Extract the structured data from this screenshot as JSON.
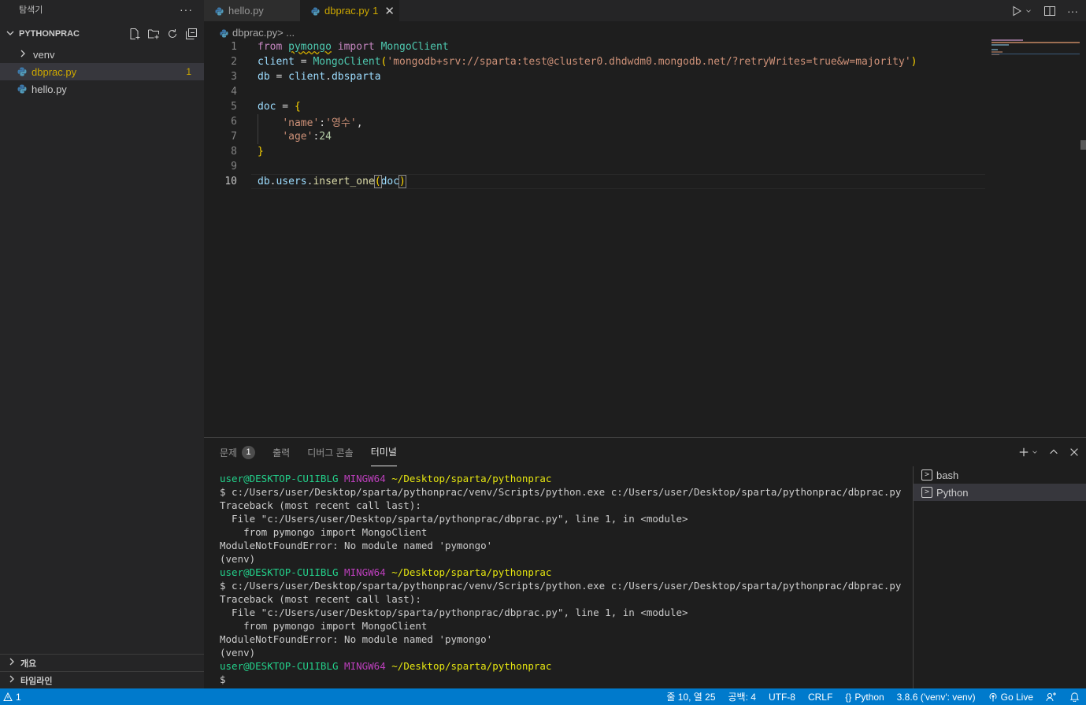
{
  "sidebar": {
    "title": "탐색기",
    "more": "···",
    "folder": "PYTHONPRAC",
    "items": [
      {
        "label": "venv",
        "type": "folder"
      },
      {
        "label": "dbprac.py",
        "type": "file",
        "badge": "1"
      },
      {
        "label": "hello.py",
        "type": "file"
      }
    ],
    "bottom": [
      "개요",
      "타임라인"
    ]
  },
  "tabs": [
    {
      "label": "hello.py"
    },
    {
      "label": "dbprac.py",
      "num": "1",
      "close": "✕"
    }
  ],
  "breadcrumb": {
    "file": "dbprac.py",
    "sep": " > ..."
  },
  "editor": {
    "line_numbers": [
      "1",
      "2",
      "3",
      "4",
      "5",
      "6",
      "7",
      "8",
      "9",
      "10"
    ],
    "current_line": "10"
  },
  "panel": {
    "tabs": [
      {
        "label": "문제",
        "count": "1"
      },
      {
        "label": "출력"
      },
      {
        "label": "디버그 콘솔"
      },
      {
        "label": "터미널"
      }
    ],
    "terminal_lines": [
      {
        "kind": "prompt",
        "user": "user@DESKTOP-CU1IBLG",
        "env": "MINGW64",
        "path": "~/Desktop/sparta/pythonprac"
      },
      {
        "kind": "text",
        "text": "$ c:/Users/user/Desktop/sparta/pythonprac/venv/Scripts/python.exe c:/Users/user/Desktop/sparta/pythonprac/dbprac.py"
      },
      {
        "kind": "text",
        "text": "Traceback (most recent call last):"
      },
      {
        "kind": "text",
        "text": "  File \"c:/Users/user/Desktop/sparta/pythonprac/dbprac.py\", line 1, in <module>"
      },
      {
        "kind": "text",
        "text": "    from pymongo import MongoClient"
      },
      {
        "kind": "text",
        "text": "ModuleNotFoundError: No module named 'pymongo'"
      },
      {
        "kind": "text",
        "text": "(venv)"
      },
      {
        "kind": "prompt",
        "user": "user@DESKTOP-CU1IBLG",
        "env": "MINGW64",
        "path": "~/Desktop/sparta/pythonprac"
      },
      {
        "kind": "text",
        "text": "$ c:/Users/user/Desktop/sparta/pythonprac/venv/Scripts/python.exe c:/Users/user/Desktop/sparta/pythonprac/dbprac.py"
      },
      {
        "kind": "text",
        "text": "Traceback (most recent call last):"
      },
      {
        "kind": "text",
        "text": "  File \"c:/Users/user/Desktop/sparta/pythonprac/dbprac.py\", line 1, in <module>"
      },
      {
        "kind": "text",
        "text": "    from pymongo import MongoClient"
      },
      {
        "kind": "text",
        "text": "ModuleNotFoundError: No module named 'pymongo'"
      },
      {
        "kind": "text",
        "text": "(venv)"
      },
      {
        "kind": "prompt",
        "user": "user@DESKTOP-CU1IBLG",
        "env": "MINGW64",
        "path": "~/Desktop/sparta/pythonprac"
      },
      {
        "kind": "text",
        "text": "$"
      }
    ],
    "terminals": [
      "bash",
      "Python"
    ]
  },
  "status": {
    "problems": "1",
    "position": "줄 10, 열 25",
    "spaces": "공백: 4",
    "encoding": "UTF-8",
    "eol": "CRLF",
    "language": "Python",
    "interpreter": "3.8.6 ('venv': venv)",
    "golive": "Go Live"
  },
  "colors": {
    "accent": "#007acc",
    "warning": "#cca700",
    "background": "#1e1e1e",
    "sidebar": "#252526"
  }
}
